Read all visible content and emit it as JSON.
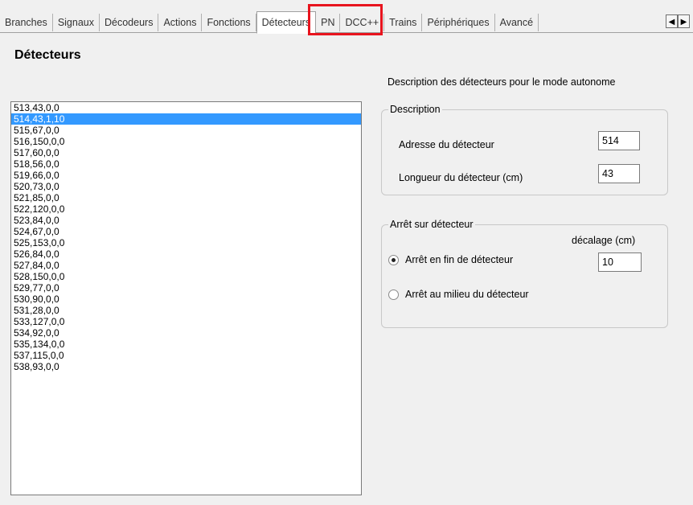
{
  "tabs": [
    {
      "label": "Branches"
    },
    {
      "label": "Signaux"
    },
    {
      "label": "Décodeurs"
    },
    {
      "label": "Actions"
    },
    {
      "label": "Fonctions"
    },
    {
      "label": "Détecteurs"
    },
    {
      "label": "PN"
    },
    {
      "label": "DCC++"
    },
    {
      "label": "Trains"
    },
    {
      "label": "Périphériques"
    },
    {
      "label": "Avancé"
    }
  ],
  "active_tab": "Détecteurs",
  "page_title": "Détecteurs",
  "subtitle": "Description des détecteurs pour le mode autonome",
  "detector_list": [
    "513,43,0,0",
    "514,43,1,10",
    "515,67,0,0",
    "516,150,0,0",
    "517,60,0,0",
    "518,56,0,0",
    "519,66,0,0",
    "520,73,0,0",
    "521,85,0,0",
    "522,120,0,0",
    "523,84,0,0",
    "524,67,0,0",
    "525,153,0,0",
    "526,84,0,0",
    "527,84,0,0",
    "528,150,0,0",
    "529,77,0,0",
    "530,90,0,0",
    "531,28,0,0",
    "533,127,0,0",
    "534,92,0,0",
    "535,134,0,0",
    "537,115,0,0",
    "538,93,0,0"
  ],
  "selected_item": "514,43,1,10",
  "description": {
    "legend": "Description",
    "address_label": "Adresse du détecteur",
    "address_value": "514",
    "length_label": "Longueur du détecteur (cm)",
    "length_value": "43"
  },
  "stop": {
    "legend": "Arrêt sur détecteur",
    "offset_label": "décalage (cm)",
    "option_end": "Arrêt en fin de détecteur",
    "option_middle": "Arrêt au milieu du détecteur",
    "offset_value": "10",
    "selected": "end"
  },
  "scroll_left": "◀",
  "scroll_right": "▶"
}
